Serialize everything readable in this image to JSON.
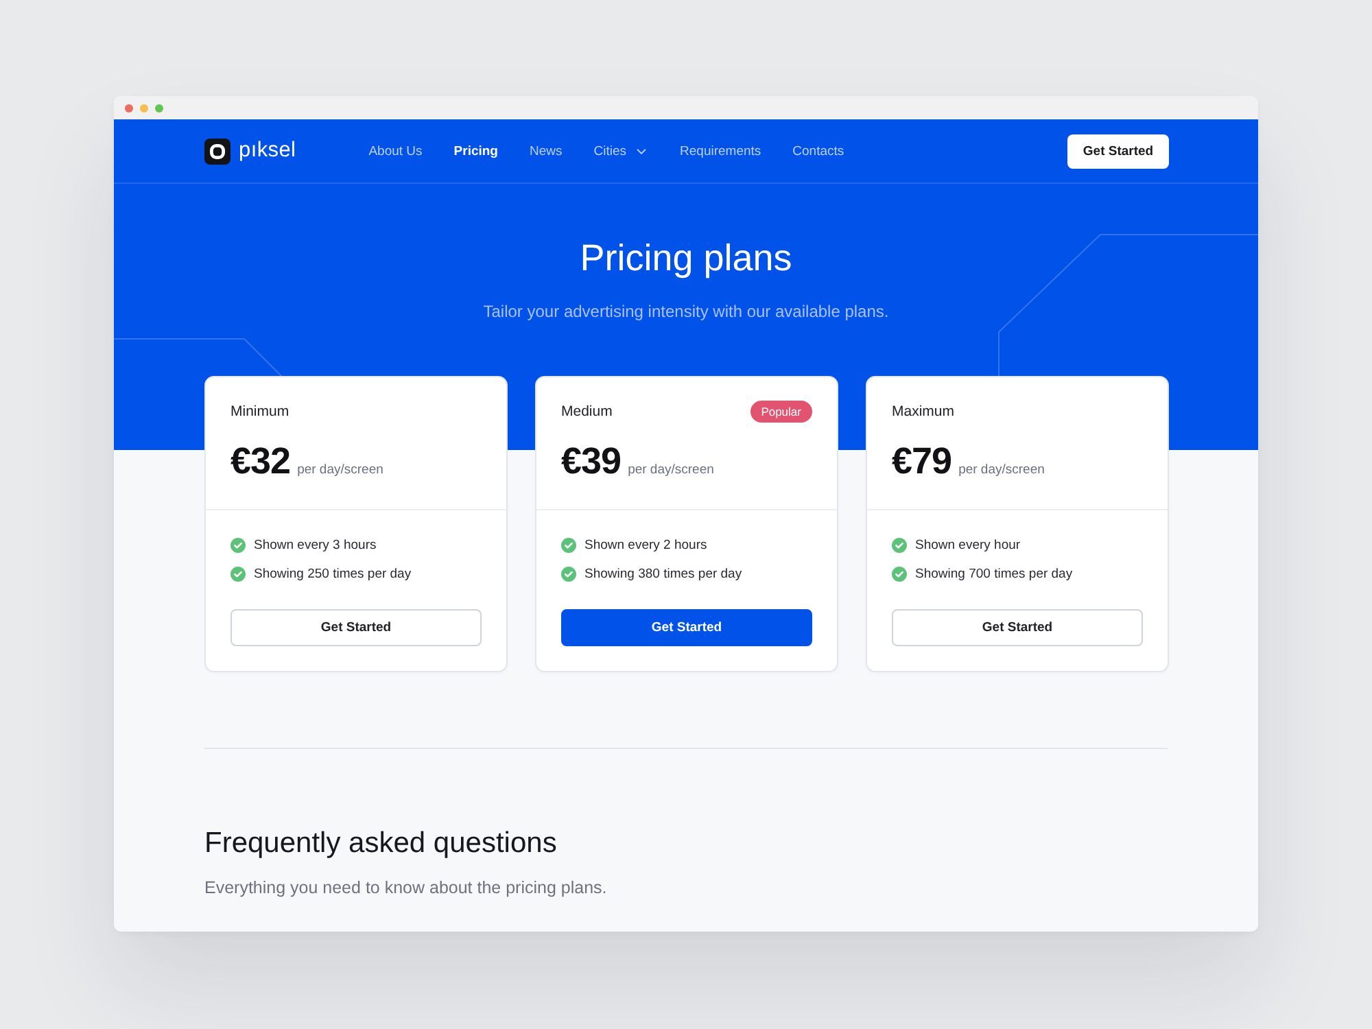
{
  "browser": {
    "dots": [
      {
        "color": "#ed6a5e"
      },
      {
        "color": "#f5bf4f"
      },
      {
        "color": "#61c554"
      }
    ]
  },
  "nav": {
    "logo": "pıksel",
    "links": [
      {
        "label": "About Us",
        "kind": "link",
        "selected": false
      },
      {
        "label": "Pricing",
        "kind": "link",
        "selected": true
      },
      {
        "label": "News",
        "kind": "link",
        "selected": false
      },
      {
        "label": "Cities",
        "kind": "dropdown",
        "selected": false
      },
      {
        "label": "Requirements",
        "kind": "link",
        "selected": false
      },
      {
        "label": "Contacts",
        "kind": "link",
        "selected": false
      }
    ],
    "cta": "Get Started"
  },
  "hero": {
    "title": "Pricing plans",
    "subtitle": "Tailor your advertising intensity with our available plans."
  },
  "plans": [
    {
      "name": "Minimum",
      "price": "€32",
      "unit": "per day/screen",
      "features": [
        "Shown every 3 hours",
        "Showing 250 times per day"
      ],
      "button": "Get Started",
      "highlighted": false
    },
    {
      "name": "Medium",
      "badge": "Popular",
      "price": "€39",
      "unit": "per day/screen",
      "features": [
        "Shown every 2 hours",
        "Showing 380 times per day"
      ],
      "button": "Get Started",
      "highlighted": true
    },
    {
      "name": "Maximum",
      "price": "€79",
      "unit": "per day/screen",
      "features": [
        "Shown every hour",
        "Showing 700 times per day"
      ],
      "button": "Get Started",
      "highlighted": false
    }
  ],
  "faq": {
    "title": "Frequently asked questions",
    "subtitle": "Everything you need to know about the pricing plans."
  }
}
